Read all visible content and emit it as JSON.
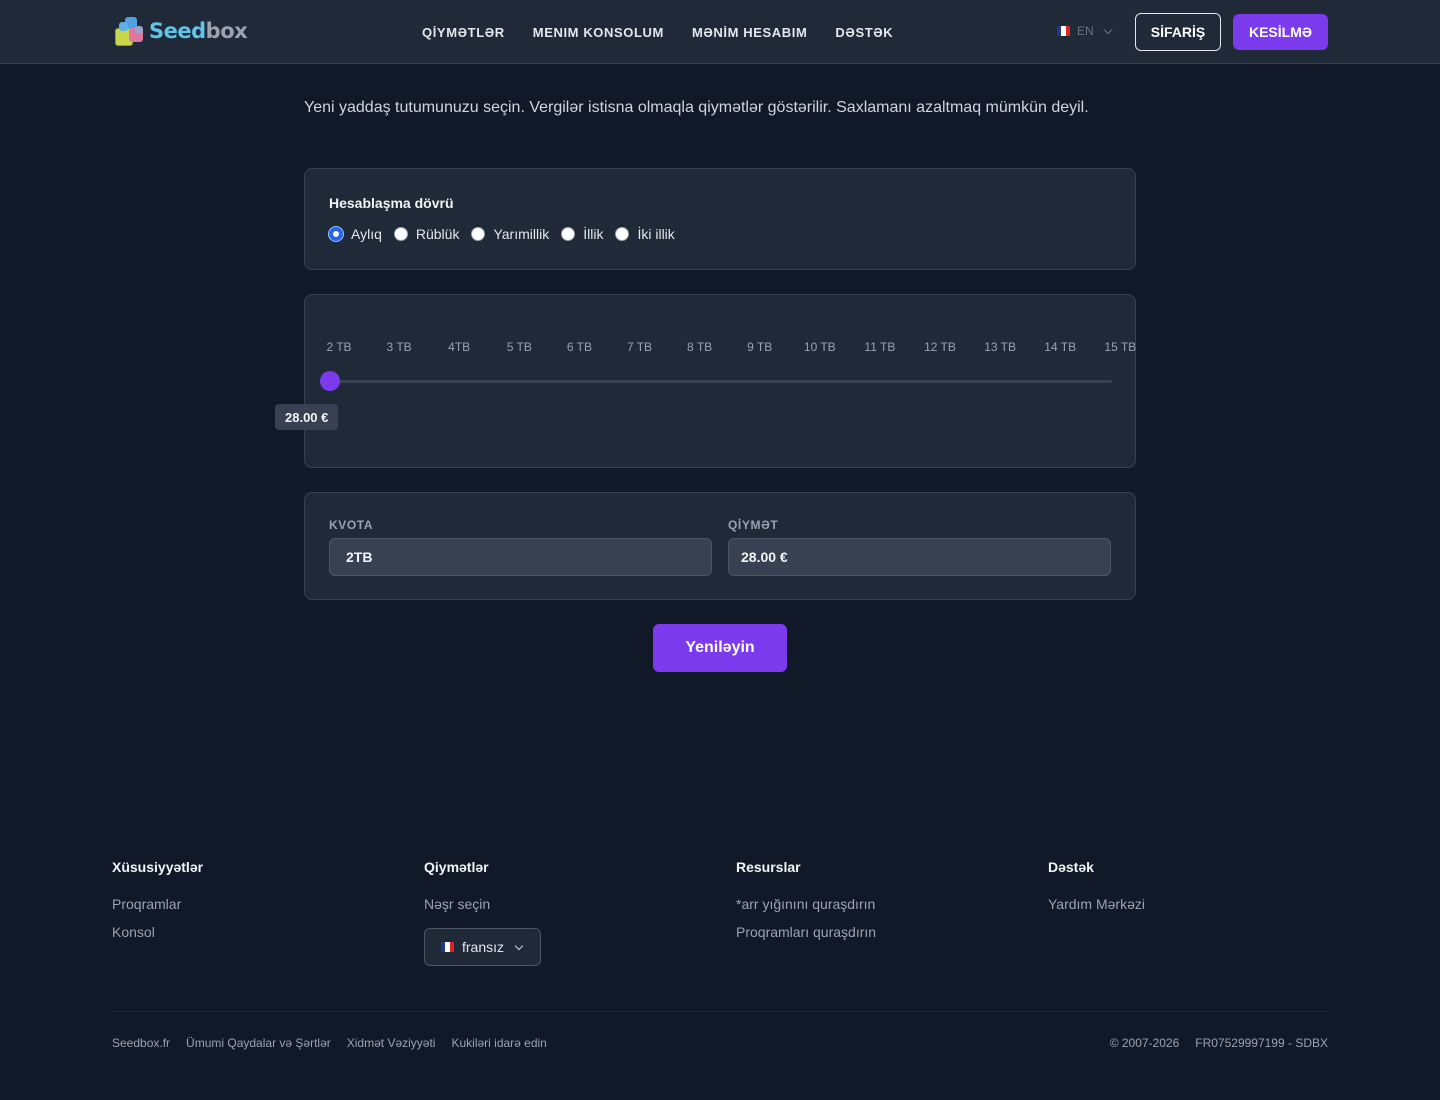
{
  "header": {
    "logo": {
      "text_part1": "Seed",
      "text_part2": "box"
    },
    "nav": [
      {
        "label": "QİYMƏTLƏR"
      },
      {
        "label": "MENIM KONSOLUM"
      },
      {
        "label": "MƏNİM HESABIM"
      },
      {
        "label": "DƏSTƏK"
      }
    ],
    "language": {
      "code": "EN",
      "flag": "french-flag-icon"
    },
    "order_button": "SİFARİŞ",
    "logout_button": "KESİLMƏ"
  },
  "main": {
    "intro": "Yeni yaddaş tutumunuzu seçin. Vergilər istisna olmaqla qiymətlər göstərilir. Saxlamanı azaltmaq mümkün deyil.",
    "billing": {
      "label": "Hesablaşma dövrü",
      "options": [
        {
          "label": "Aylıq",
          "checked": true
        },
        {
          "label": "Rüblük",
          "checked": false
        },
        {
          "label": "Yarımillik",
          "checked": false
        },
        {
          "label": "İllik",
          "checked": false
        },
        {
          "label": "İki illik",
          "checked": false
        }
      ]
    },
    "slider": {
      "ticks": [
        "2 TB",
        "3 TB",
        "4TB",
        "5 TB",
        "6 TB",
        "7 TB",
        "8 TB",
        "9 TB",
        "10 TB",
        "11 TB",
        "12 TB",
        "13 TB",
        "14 TB",
        "15 TB"
      ],
      "selected_index": 0,
      "price_tooltip": "28.00 €"
    },
    "quota": {
      "label": "KVOTA",
      "value": "2TB"
    },
    "price": {
      "label": "QİYMƏT",
      "value": "28.00 €"
    },
    "renew_button": "Yeniləyin"
  },
  "footer": {
    "columns": [
      {
        "title": "Xüsusiyyətlər",
        "links": [
          "Proqramlar",
          "Konsol"
        ]
      },
      {
        "title": "Qiymətlər",
        "links": [
          "Nəşr seçin"
        ]
      },
      {
        "title": "Resurslar",
        "links": [
          "*arr yığınını quraşdırın",
          "Proqramları quraşdırın"
        ]
      },
      {
        "title": "Dəstək",
        "links": [
          "Yardım Mərkəzi"
        ]
      }
    ],
    "language_select": {
      "value": "fransız",
      "flag": "french-flag-icon"
    },
    "legal_links": [
      "Seedbox.fr",
      "Ümumi Qaydalar və Şərtlər",
      "Xidmət Vəziyyəti",
      "Kukiləri idarə edin"
    ],
    "copyright": "© 2007-2026",
    "company_id": "FR07529997199 - SDBX"
  },
  "colors": {
    "background": "#111827",
    "surface": "#1f2937",
    "accent": "#7c3aed",
    "radio_selected": "#2563eb"
  }
}
